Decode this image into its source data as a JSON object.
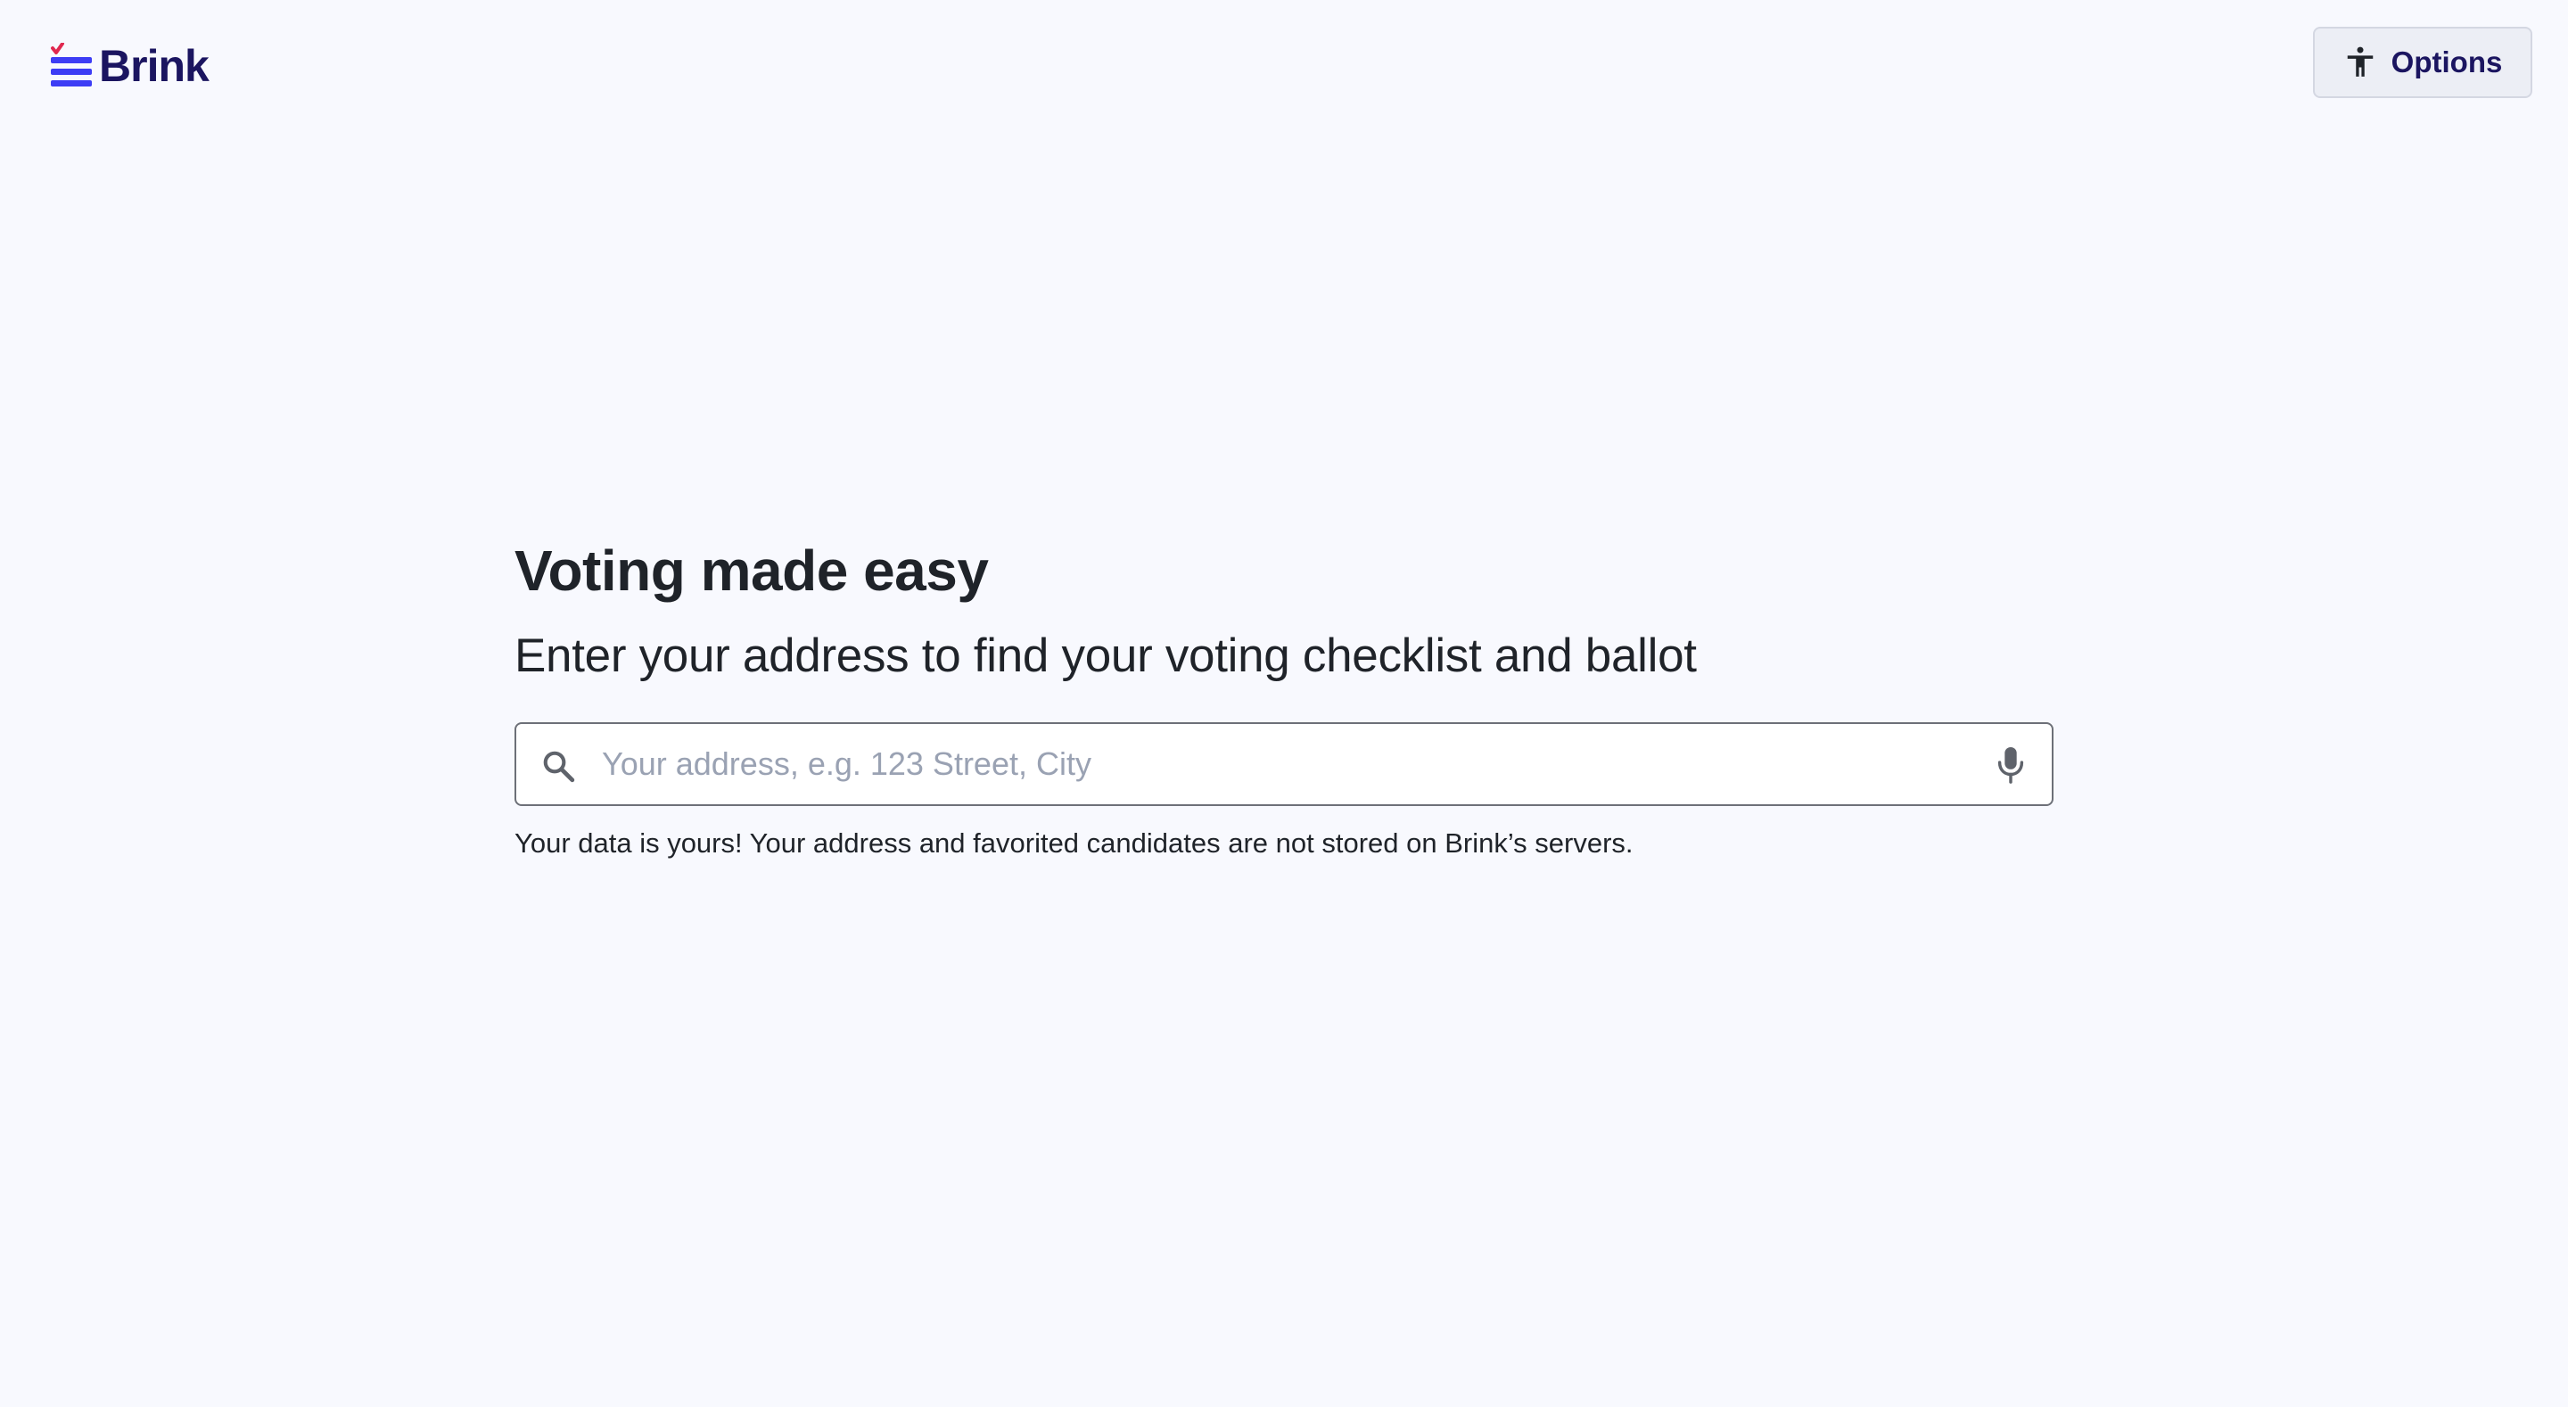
{
  "header": {
    "logo_text": "Brink",
    "options_label": "Options",
    "options_icon": "accessibility-icon"
  },
  "hero": {
    "title": "Voting made easy",
    "subtitle": "Enter your address to find your voting checklist and ballot"
  },
  "search": {
    "placeholder": "Your address, e.g. 123 Street, City",
    "value": "",
    "left_icon": "search-icon",
    "right_icon": "microphone-icon"
  },
  "privacy_note": "Your data is yours! Your address and favorited candidates are not stored on Brink’s servers.",
  "colors": {
    "background": "#f8f9fe",
    "brand_navy": "#1b1560",
    "brand_blue": "#3d3df5",
    "brand_red": "#e0284f",
    "text": "#1f2329",
    "placeholder": "#9aa2b3"
  }
}
